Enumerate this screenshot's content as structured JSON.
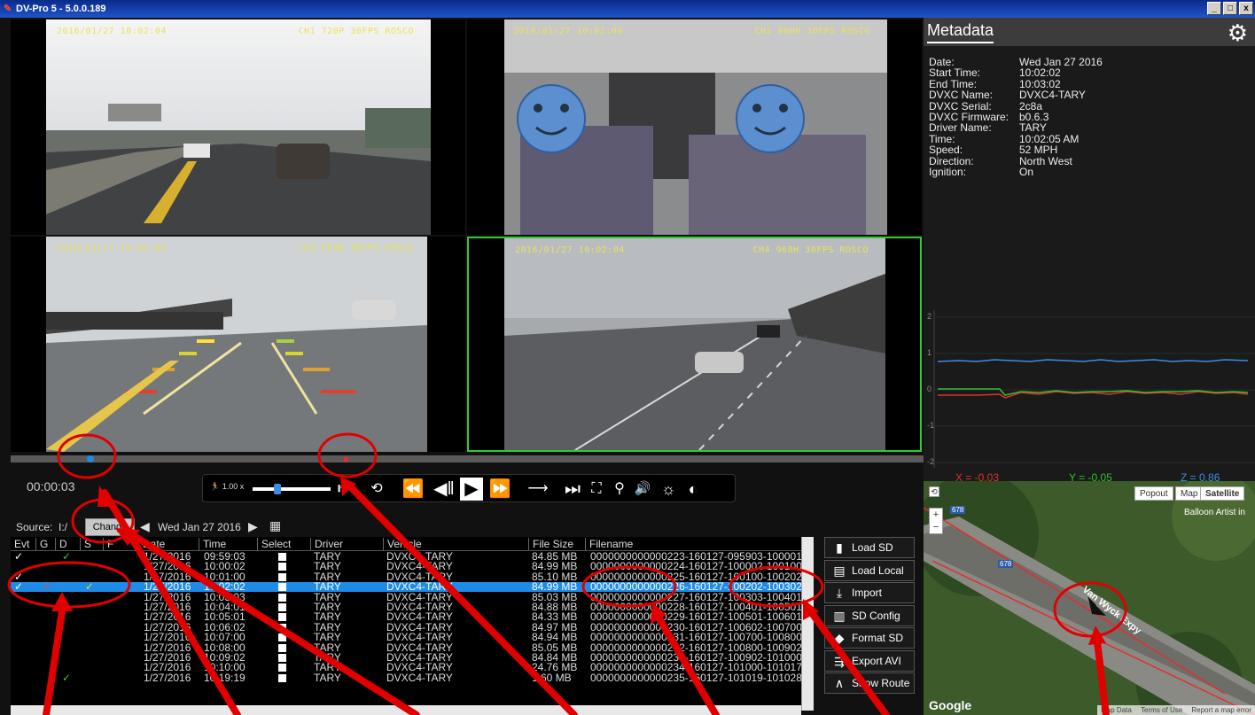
{
  "window": {
    "title": "DV-Pro 5 - 5.0.0.189",
    "controls": [
      "_",
      "□",
      "x"
    ]
  },
  "cameras": [
    {
      "timestamp": "2016/01/27 10:02:04",
      "label": "CH1 720P 30FPS ROSCO"
    },
    {
      "timestamp": "2016/01/27 10:02:04",
      "label": "CH2 960H 30FPS ROSCO"
    },
    {
      "timestamp": "2016/01/27 10:02:04",
      "label": "CH3 960H 30FPS ROSCO"
    },
    {
      "timestamp": "2016/01/27 10:02:04",
      "label": "CH4 960H 30FPS ROSCO"
    }
  ],
  "player": {
    "timecode": "00:00:03",
    "speed": "1.00 x",
    "playhead_fraction": 0.087
  },
  "source": {
    "label": "Source:",
    "path": "I:/",
    "change_label": "Change",
    "date": "Wed Jan 27 2016"
  },
  "table": {
    "headers": [
      "Evt",
      "G",
      "D",
      "S",
      "F",
      "Date",
      "Time",
      "Select",
      "Driver",
      "Vehicle",
      "File Size",
      "Filename"
    ],
    "rows": [
      {
        "evt": "✓",
        "g": "",
        "d": "✓",
        "s": "",
        "date": "1/27/2016",
        "time": "09:59:03",
        "driver": "TARY",
        "vehicle": "DVXC4-TARY",
        "size": "84.85 MB",
        "file": "0000000000000223-160127-095903-100001"
      },
      {
        "evt": "",
        "g": "",
        "d": "",
        "s": "",
        "date": "1/27/2016",
        "time": "10:00:02",
        "driver": "TARY",
        "vehicle": "DVXC4-TARY",
        "size": "84.99 MB",
        "file": "0000000000000224-160127-100002-100100"
      },
      {
        "evt": "✓",
        "g": "",
        "d": "",
        "s": "",
        "date": "1/27/2016",
        "time": "10:01:00",
        "driver": "TARY",
        "vehicle": "DVXC4-TARY",
        "size": "85.10 MB",
        "file": "0000000000000225-160127-100100-100202"
      },
      {
        "evt": "✓",
        "g": "✓",
        "d": "",
        "s": "✓",
        "date": "1/27/2016",
        "time": "10:02:02",
        "driver": "TARY",
        "vehicle": "DVXC4-TARY",
        "size": "84.99 MB",
        "file": "0000000000000226-160127-100202-100302"
      },
      {
        "evt": "",
        "g": "",
        "d": "",
        "s": "",
        "date": "1/27/2016",
        "time": "10:03:03",
        "driver": "TARY",
        "vehicle": "DVXC4-TARY",
        "size": "85.03 MB",
        "file": "0000000000000227-160127-100303-100401"
      },
      {
        "evt": "",
        "g": "",
        "d": "",
        "s": "",
        "date": "1/27/2016",
        "time": "10:04:01",
        "driver": "TARY",
        "vehicle": "DVXC4-TARY",
        "size": "84.88 MB",
        "file": "0000000000000228-160127-100401-100501"
      },
      {
        "evt": "",
        "g": "",
        "d": "",
        "s": "",
        "date": "1/27/2016",
        "time": "10:05:01",
        "driver": "TARY",
        "vehicle": "DVXC4-TARY",
        "size": "84.33 MB",
        "file": "0000000000000229-160127-100501-100601"
      },
      {
        "evt": "",
        "g": "",
        "d": "",
        "s": "",
        "date": "1/27/2016",
        "time": "10:06:02",
        "driver": "TARY",
        "vehicle": "DVXC4-TARY",
        "size": "84.97 MB",
        "file": "0000000000000230-160127-100602-100700"
      },
      {
        "evt": "",
        "g": "",
        "d": "",
        "s": "",
        "date": "1/27/2016",
        "time": "10:07:00",
        "driver": "TARY",
        "vehicle": "DVXC4-TARY",
        "size": "84.94 MB",
        "file": "0000000000000231-160127-100700-100800"
      },
      {
        "evt": "",
        "g": "",
        "d": "",
        "s": "",
        "date": "1/27/2016",
        "time": "10:08:00",
        "driver": "TARY",
        "vehicle": "DVXC4-TARY",
        "size": "85.05 MB",
        "file": "0000000000000232-160127-100800-100902"
      },
      {
        "evt": "",
        "g": "",
        "d": "",
        "s": "",
        "date": "1/27/2016",
        "time": "10:09:02",
        "driver": "TARY",
        "vehicle": "DVXC4-TARY",
        "size": "84.84 MB",
        "file": "0000000000000233-160127-100902-101000"
      },
      {
        "evt": "",
        "g": "",
        "d": "",
        "s": "",
        "date": "1/27/2016",
        "time": "10:10:00",
        "driver": "TARY",
        "vehicle": "DVXC4-TARY",
        "size": "24.76 MB",
        "file": "0000000000000234-160127-101000-101017"
      },
      {
        "evt": "",
        "g": "",
        "d": "✓",
        "s": "",
        "date": "1/27/2016",
        "time": "10:19:19",
        "driver": "TARY",
        "vehicle": "DVXC4-TARY",
        "size": "1.60 MB",
        "file": "0000000000000235-160127-101019-101028"
      }
    ],
    "selected_index": 3
  },
  "side_buttons": [
    {
      "label": "Load SD",
      "icon": "sd-card-icon"
    },
    {
      "label": "Load Local",
      "icon": "hard-drive-icon"
    },
    {
      "label": "Import",
      "icon": "download-icon"
    },
    {
      "label": "SD Config",
      "icon": "config-icon"
    },
    {
      "label": "Format SD",
      "icon": "format-icon"
    },
    {
      "label": "Export AVI",
      "icon": "export-icon"
    },
    {
      "label": "Show Route",
      "icon": "route-icon"
    }
  ],
  "metadata": {
    "tab": "Metadata",
    "items": [
      {
        "k": "Date:",
        "v": "Wed Jan 27 2016"
      },
      {
        "k": "Start Time:",
        "v": "10:02:02"
      },
      {
        "k": "End Time:",
        "v": "10:03:02"
      },
      {
        "k": "DVXC Name:",
        "v": "DVXC4-TARY"
      },
      {
        "k": "DVXC Serial:",
        "v": "2c8a"
      },
      {
        "k": "DVXC Firmware:",
        "v": "b0.6.3"
      },
      {
        "k": "Driver Name:",
        "v": "TARY"
      },
      {
        "k": "Time:",
        "v": "10:02:05 AM"
      },
      {
        "k": "Speed:",
        "v": "52 MPH"
      },
      {
        "k": "Direction:",
        "v": "North West"
      },
      {
        "k": "Ignition:",
        "v": "On"
      }
    ]
  },
  "gsensor": {
    "y_ticks": [
      "2",
      "1",
      "0",
      "-1",
      "-2"
    ],
    "x_label": "X = -0.03",
    "y_label": "Y = -0.05",
    "z_label": "Z = 0.86",
    "colors": {
      "x": "#e03030",
      "y": "#30c030",
      "z": "#3a8de0"
    }
  },
  "map": {
    "buttons": [
      "Popout",
      "Map",
      "Satellite"
    ],
    "place_label": "Balloon Artist in",
    "road_label": "Van Wyck Expy",
    "route_678": "678",
    "footer": [
      "Map Data",
      "Terms of Use",
      "Report a map error"
    ],
    "google": "Google"
  }
}
